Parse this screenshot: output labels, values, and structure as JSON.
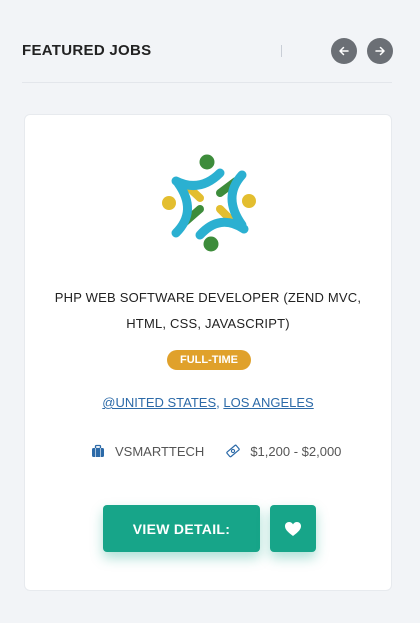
{
  "section": {
    "title": "FEATURED JOBS"
  },
  "navigation": {
    "prev_icon": "arrow-left-icon",
    "next_icon": "arrow-right-icon"
  },
  "job": {
    "title_line1": "PHP WEB SOFTWARE DEVELOPER (ZEND MVC,",
    "title_line2": "HTML, CSS, JAVASCRIPT)",
    "type": "FULL-TIME",
    "location_country": "@UNITED STATES",
    "location_separator": ", ",
    "location_city": "LOS ANGELES",
    "company": "VSMARTTECH",
    "salary": "$1,200 - $2,000",
    "company_icon": "briefcase-icon",
    "salary_icon": "money-icon"
  },
  "actions": {
    "detail_label": "VIEW DETAIL:",
    "favorite_icon": "heart-icon"
  },
  "colors": {
    "accent": "#17a589",
    "badge": "#e0a12b",
    "link": "#2c6aa8",
    "nav_button": "#6b6f75"
  }
}
